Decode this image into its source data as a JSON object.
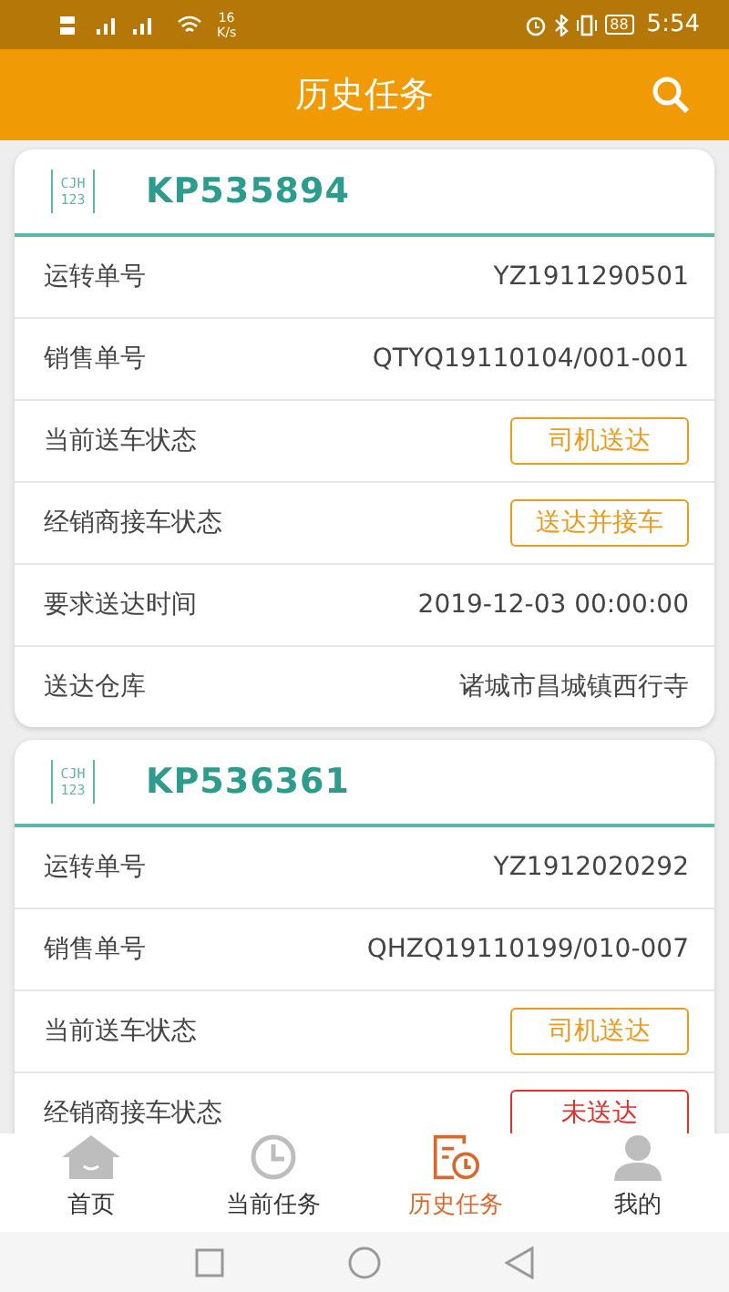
{
  "status_bar": {
    "speed_value": "16",
    "speed_unit": "K/s",
    "battery": "88",
    "time": "5:54"
  },
  "app_bar": {
    "title": "历史任务"
  },
  "tasks": [
    {
      "logo_lines": [
        "CJH",
        "123"
      ],
      "code": "KP535894",
      "rows": [
        {
          "kind": "text",
          "label": "运转单号",
          "value": "YZ1911290501"
        },
        {
          "kind": "text",
          "label": "销售单号",
          "value": "QTYQ19110104/001-001"
        },
        {
          "kind": "badge",
          "label": "当前送车状态",
          "value": "司机送达",
          "color": "#eb9a1e"
        },
        {
          "kind": "badge",
          "label": "经销商接车状态",
          "value": "送达并接车",
          "color": "#eb9a1e"
        },
        {
          "kind": "text",
          "label": "要求送达时间",
          "value": "2019-12-03 00:00:00"
        },
        {
          "kind": "text",
          "label": "送达仓库",
          "value": "诸城市昌城镇西行寺"
        }
      ]
    },
    {
      "logo_lines": [
        "CJH",
        "123"
      ],
      "code": "KP536361",
      "rows": [
        {
          "kind": "text",
          "label": "运转单号",
          "value": "YZ1912020292"
        },
        {
          "kind": "text",
          "label": "销售单号",
          "value": "QHZQ19110199/010-007"
        },
        {
          "kind": "badge",
          "label": "当前送车状态",
          "value": "司机送达",
          "color": "#eb9a1e"
        },
        {
          "kind": "badge",
          "label": "经销商接车状态",
          "value": "未送达",
          "color": "#e0302a"
        }
      ]
    }
  ],
  "tab_bar": [
    {
      "kind": "home",
      "label": "首页",
      "selected": false
    },
    {
      "kind": "clock",
      "label": "当前任务",
      "selected": false
    },
    {
      "kind": "history",
      "label": "历史任务",
      "selected": true
    },
    {
      "kind": "user",
      "label": "我的",
      "selected": false
    }
  ]
}
